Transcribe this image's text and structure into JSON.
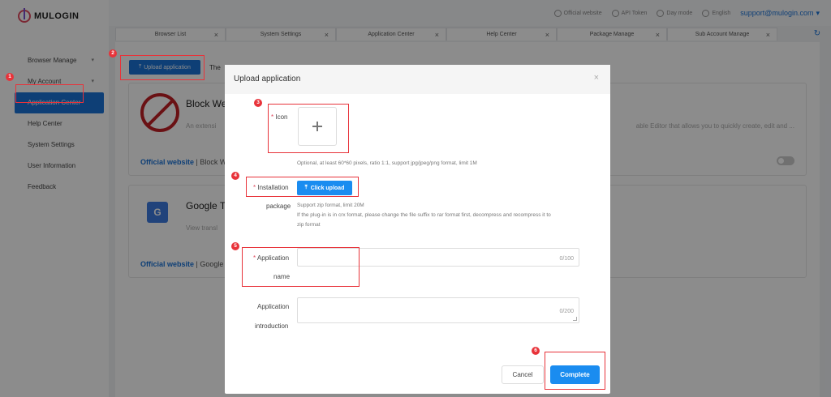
{
  "app": {
    "logo_text": "MULOGIN"
  },
  "sidebar": {
    "items": [
      {
        "label": "Browser Manage",
        "chevron": "▾"
      },
      {
        "label": "My Account",
        "chevron": "▾"
      },
      {
        "label": "Application Center",
        "active": true
      },
      {
        "label": "Help Center"
      },
      {
        "label": "System Settings"
      },
      {
        "label": "User Information"
      },
      {
        "label": "Feedback"
      }
    ]
  },
  "topbar": {
    "official_website": "Official website",
    "api_token": "API Token",
    "day_mode": "Day mode",
    "language": "English",
    "email": "support@mulogin.com",
    "chevron": "▾"
  },
  "tabs": [
    {
      "label": "Browser List",
      "close": "×"
    },
    {
      "label": "System Settings",
      "close": "×"
    },
    {
      "label": "Application Center",
      "close": "×"
    },
    {
      "label": "Help Center",
      "close": "×"
    },
    {
      "label": "Package Manage",
      "close": "×"
    },
    {
      "label": "Sub Account Manage",
      "close": "×"
    }
  ],
  "page": {
    "upload_button": "Upload application",
    "upload_icon": "⤒",
    "hint_text": "The",
    "apps": [
      {
        "name": "Block We",
        "desc": "An extensi",
        "desc_right": "able Editor that allows you to quickly create, edit and ...",
        "link": "Official website",
        "link_suffix": "| Block W"
      },
      {
        "name": "Google Tr",
        "desc": "View transl",
        "link": "Official website",
        "link_suffix": "| Google",
        "icon_letter": "G"
      }
    ],
    "refresh_icon": "↻"
  },
  "modal": {
    "title": "Upload application",
    "close": "×",
    "icon_label": "Icon",
    "icon_hint": "Optional, at least 60*60 pixels, ratio 1:1, support jpg/jpeg/png format, limit 1M",
    "installation_label": "Installation",
    "package_label": "package",
    "click_upload": "Click upload",
    "upload_icon": "⤒",
    "package_hint_1": "Support zip format, limit 20M",
    "package_hint_2": "If the plug-in is in crx format, please change the file suffix to rar format first, decompress and recompress it to",
    "package_hint_3": "zip format",
    "app_name_label": "Application",
    "app_name_label_2": "name",
    "app_name_count": "0/100",
    "app_intro_label": "Application",
    "app_intro_label_2": "introduction",
    "app_intro_count": "0/200",
    "required_mark": "*",
    "cancel": "Cancel",
    "complete": "Complete"
  },
  "annotations": [
    "1",
    "2",
    "3",
    "4",
    "5",
    "6"
  ],
  "colors": {
    "primary": "#1a73d8",
    "annotation_red": "#e8333a"
  }
}
